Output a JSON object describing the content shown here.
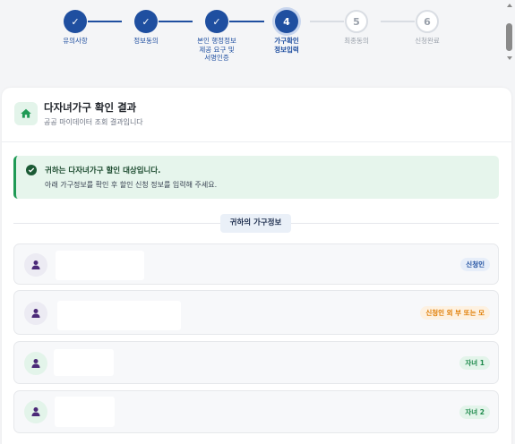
{
  "stepper": {
    "steps": [
      {
        "number": "✓",
        "label": "유의사항",
        "state": "done"
      },
      {
        "number": "✓",
        "label": "정보동의",
        "state": "done"
      },
      {
        "number": "✓",
        "label": "본인 행정정보\n제공 요구 및\n서명인증",
        "state": "done"
      },
      {
        "number": "4",
        "label": "가구확인\n정보입력",
        "state": "active"
      },
      {
        "number": "5",
        "label": "최종동의",
        "state": "todo"
      },
      {
        "number": "6",
        "label": "신청완료",
        "state": "todo"
      }
    ]
  },
  "result": {
    "icon": "home-icon",
    "title": "다자녀가구 확인 결과",
    "subtitle": "공공 마이데이터 조회 결과입니다"
  },
  "alert": {
    "icon": "check-circle-icon",
    "title": "귀하는 다자녀가구 할인 대상입니다.",
    "description": "아래 가구정보를 확인 후 할인 신청 정보를 입력해 주세요."
  },
  "household": {
    "section_label": "귀하의 가구정보",
    "members": [
      {
        "icon": "person-icon",
        "role": "신청인",
        "badge_color": "#1f4fa0",
        "badge_bg": "#e7eef9"
      },
      {
        "icon": "person-icon",
        "role": "신청인 외 부 또는 모",
        "badge_color": "#e07b00",
        "badge_bg": "#fdf1e1"
      },
      {
        "icon": "person-icon",
        "role": "자녀 1",
        "badge_color": "#1f8a4c",
        "badge_bg": "#e3f4ea"
      },
      {
        "icon": "person-icon",
        "role": "자녀 2",
        "badge_color": "#1f8a4c",
        "badge_bg": "#e3f4ea"
      }
    ]
  },
  "colors": {
    "primary": "#1f4fa0",
    "success": "#1f9a55",
    "avatar": "#4b2a78"
  }
}
